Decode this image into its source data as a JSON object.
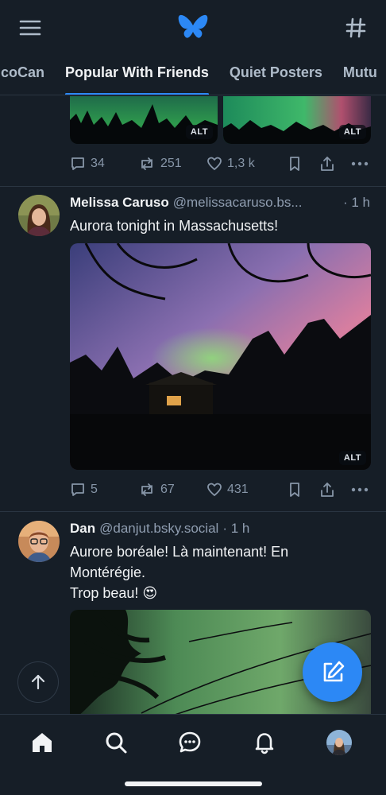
{
  "tabs": [
    {
      "label": "Popular With Friends",
      "partial_label": "coCan"
    },
    {
      "label": "Popular With Friends"
    },
    {
      "label": "Quiet Posters"
    },
    {
      "label": "Mutu"
    }
  ],
  "active_tab": "Popular With Friends",
  "previous_post": {
    "images": [
      {
        "alt_badge": "ALT"
      },
      {
        "alt_badge": "ALT"
      }
    ],
    "stats": {
      "replies": "34",
      "reposts": "251",
      "likes": "1,3 k"
    }
  },
  "posts": [
    {
      "author": "Melissa Caruso",
      "handle": "@melissacaruso.bs...",
      "time": "· 1 h",
      "text_lines": [
        "Aurora tonight in Massachusetts!"
      ],
      "image": {
        "alt_badge": "ALT"
      },
      "stats": {
        "replies": "5",
        "reposts": "67",
        "likes": "431"
      }
    },
    {
      "author": "Dan",
      "handle": "@danjut.bsky.social",
      "time": "· 1 h",
      "text_lines": [
        "Aurore boréale! Là maintenant! En",
        "Montérégie.",
        "Trop beau! 😍"
      ]
    }
  ],
  "colors": {
    "background": "#161e27",
    "accent": "#2c88f5",
    "muted_text": "#8796a8",
    "divider": "#2a3542"
  },
  "icons": {
    "top_left": "menu-icon",
    "top_center": "bluesky-butterfly-logo",
    "top_right": "hashtag-icon",
    "nav": [
      "home-icon",
      "search-icon",
      "chat-icon",
      "bell-icon",
      "profile-avatar"
    ],
    "fab": "compose-icon",
    "scroll": "arrow-up-icon"
  }
}
